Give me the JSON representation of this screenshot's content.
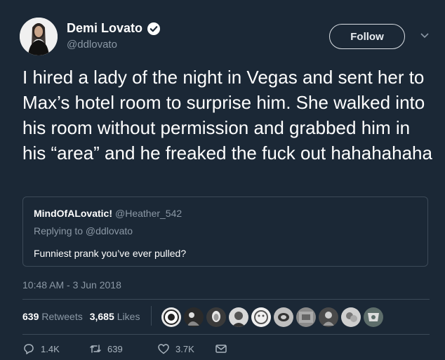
{
  "author": {
    "name": "Demi Lovato",
    "handle": "@ddlovato",
    "verified": true
  },
  "header": {
    "follow_label": "Follow"
  },
  "tweet": {
    "text": "I hired a lady of the night in Vegas and sent her to Max’s hotel room to surprise him. She walked into his room without permission and grabbed him in his “area” and he freaked the fuck out hahahahaha",
    "timestamp": "10:48 AM - 3 Jun 2018"
  },
  "quoted": {
    "name": "MindOfALovatic!",
    "handle": "@Heather_542",
    "replying_to": "Replying to @ddlovato",
    "text": "Funniest prank you’ve ever pulled?"
  },
  "stats": {
    "retweets_count": "639",
    "retweets_label": "Retweets",
    "likes_count": "3,685",
    "likes_label": "Likes"
  },
  "actions": {
    "replies": "1.4K",
    "retweets": "639",
    "likes": "3.7K"
  },
  "colors": {
    "background": "#1b2836",
    "secondary_text": "#8b98a5",
    "verified_badge": "#ffffff"
  }
}
